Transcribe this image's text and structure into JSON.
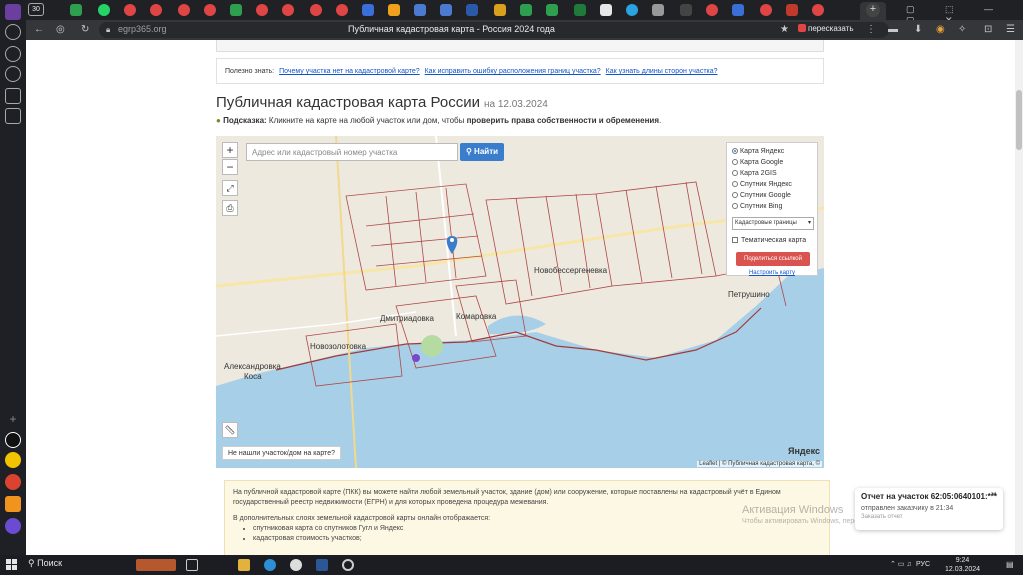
{
  "browser": {
    "tab_count": "30",
    "url": "egrp365.org",
    "page_title": "Публичная кадастровая карта - Россия 2024 года",
    "share_label": "пересказать"
  },
  "infobox": {
    "prefix": "Полезно знать:",
    "links": [
      "Почему участка нет на кадастровой карте?",
      "Как исправить ошибку расположения границ участка?",
      "Как узнать длины сторон участка?"
    ]
  },
  "heading": {
    "title": "Публичная кадастровая карта России",
    "date": "на 12.03.2024"
  },
  "hint": {
    "label": "Подсказка:",
    "text": "Кликните на карте на любой участок или дом, чтобы",
    "bold": "проверить права собственности и обременения"
  },
  "map": {
    "search_placeholder": "Адрес или кадастровый номер участка",
    "search_button": "Найти",
    "zoom_in": "+",
    "zoom_out": "−",
    "layers": [
      {
        "label": "Карта Яндекс",
        "selected": true
      },
      {
        "label": "Карта Google",
        "selected": false
      },
      {
        "label": "Карта 2GIS",
        "selected": false
      },
      {
        "label": "Спутник Яндекс",
        "selected": false
      },
      {
        "label": "Спутник Google",
        "selected": false
      },
      {
        "label": "Спутник Bing",
        "selected": false
      }
    ],
    "overlay_select": "Кадастровые границы",
    "thematic_label": "Тематическая карта",
    "share_link_button": "Поделиться ссылкой",
    "setup_link": "Настроить карту",
    "not_found_button": "Не нашли участок/дом на карте?",
    "attribution": "Leaflet | © Публичная кадастровая карта, ©",
    "provider_logo": "Яндекс",
    "places": {
      "novobessergenevka": "Новобессергеневка",
      "dmitriadovka": "Дмитриадовка",
      "komarovka": "Комаровка",
      "novozolotovka": "Новозолотовка",
      "aleksandrovka_1": "Александровка",
      "aleksandrovka_2": "Коса",
      "petrushino": "Петрушино"
    }
  },
  "note": {
    "p1": "На публичной кадастровой карте (ПКК) вы можете найти любой земельный участок, здание (дом) или сооружение, которые поставлены на кадастровый учёт в Едином государственный реестр недвижимости (ЕГРН) и для которых проведена процедура межевания.",
    "p2": "В дополнительных слоях земельной кадастровой карты онлайн отображается:",
    "items": [
      "спутниковая карта со спутников Гугл и Яндекс",
      "кадастровая стоимость участков;"
    ]
  },
  "activation": {
    "title": "Активация Windows",
    "text": "Чтобы активировать Windows, перейдите в раздел"
  },
  "toast": {
    "title": "Отчет на участок 62:05:0640101:***",
    "sub": "отправлен заказчику в 21:34",
    "sub2": "Заказать отчет"
  },
  "taskbar": {
    "search": "Поиск",
    "lang": "РУС",
    "time": "9:24",
    "date": "12.03.2024"
  }
}
